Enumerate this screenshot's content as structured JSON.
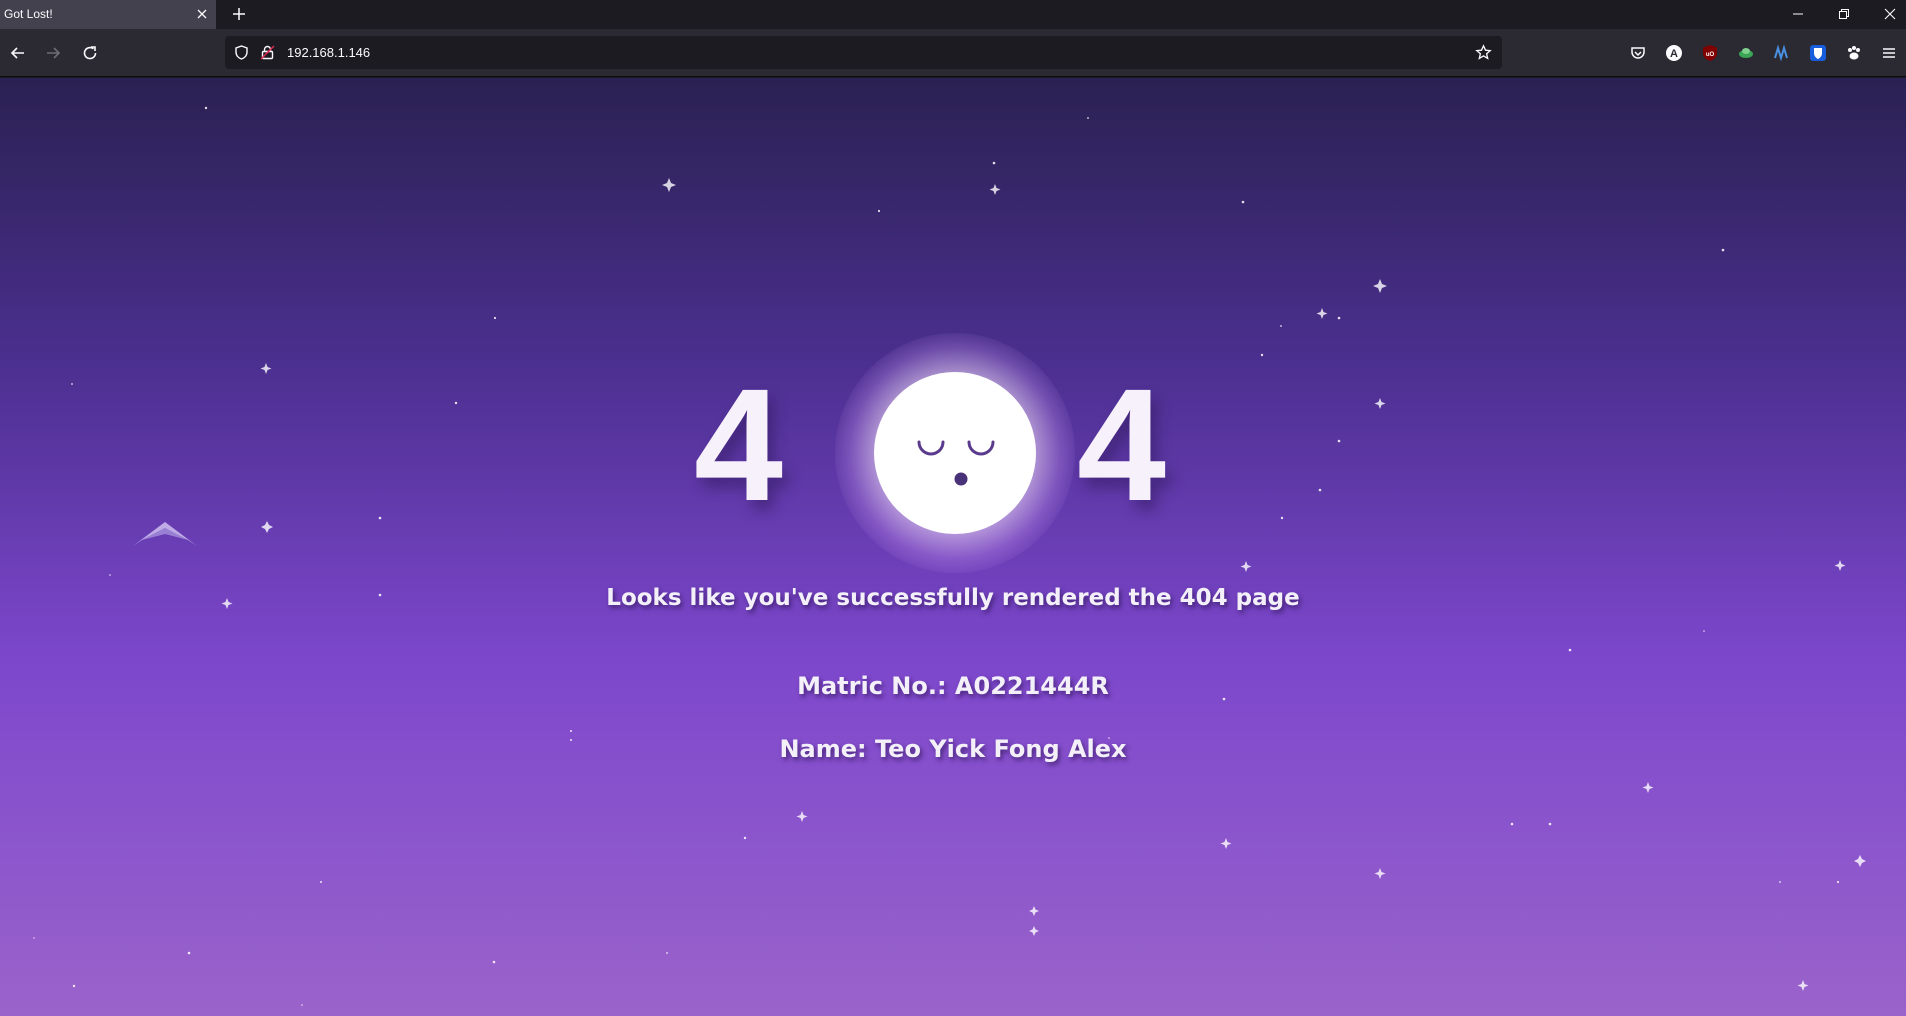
{
  "browser": {
    "tab_title": "Got Lost!",
    "url": "192.168.1.146"
  },
  "icons": {
    "tab_close": "close-icon",
    "new_tab": "plus-icon",
    "minimize": "minimize-icon",
    "restore": "restore-icon",
    "close_window": "close-icon",
    "back": "arrow-left-icon",
    "forward": "arrow-right-icon",
    "reload": "reload-icon",
    "tracking_protection": "shield-icon",
    "connection": "lock-icon",
    "bookmark": "star-icon",
    "pocket": "pocket-icon",
    "menu": "hamburger-icon"
  },
  "page": {
    "digit_left": "4",
    "digit_right": "4",
    "message": "Looks like you've successfully rendered the 404 page",
    "matric": "Matric No.: A0221444R",
    "name": "Name: Teo Yick Fong Alex"
  },
  "colors": {
    "gradient_top": "#2a2152",
    "gradient_mid": "#7d47cc",
    "gradient_bottom": "#9a63cb",
    "moon": "#ffffff",
    "text": "#f4f0fa"
  }
}
